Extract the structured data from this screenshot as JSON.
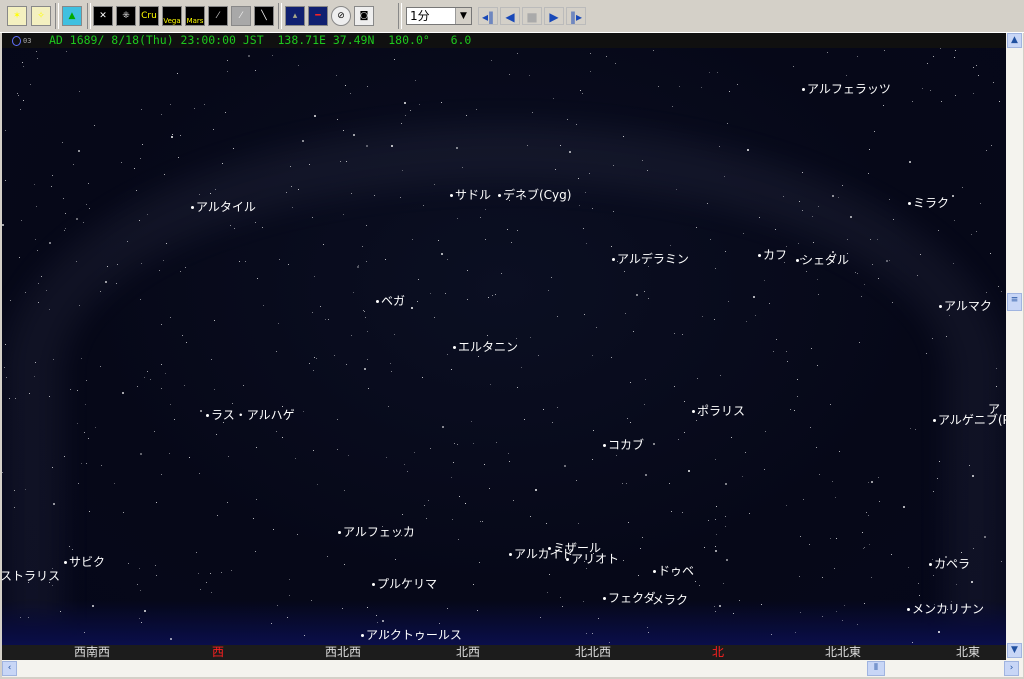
{
  "toolbar": {
    "buttons": [
      "star-brighter",
      "star-fainter",
      "landscape",
      "constellation-lines",
      "constellation-boundaries",
      "constellation-names",
      "Vega",
      "Mars",
      "comet",
      "meteor",
      "milky-way",
      "grid-horizon",
      "grid-equator",
      "telescope",
      "camera"
    ],
    "cru_label": "Cru",
    "vega_label": "Vega",
    "mars_label": "Mars",
    "speed": "1分",
    "playback": [
      "step-back",
      "reverse",
      "stop",
      "play",
      "step-forward"
    ]
  },
  "status": {
    "moon_age": "03",
    "text": "AD 1689/ 8/18(Thu) 23:00:00 JST  138.71E 37.49N  180.0°   6.0"
  },
  "stars": [
    "アルフェラッツ",
    "アルタイル",
    "サドル",
    "デネブ(Cyg)",
    "ミラク",
    "アルデラミン",
    "カフ",
    "シェダル",
    "ベガ",
    "アルマク",
    "エルタニン",
    "ラス・アルハゲ",
    "ポラリス",
    "アルゲニブ(P",
    "ア",
    "コカブ",
    "アルフェッカ",
    "サビク",
    "ストラリス",
    "アルカイド",
    "ミザール",
    "アリオト",
    "ドゥベ",
    "カペラ",
    "プルケリマ",
    "フェクダ",
    "メラク",
    "メンカリナン",
    "アルクトゥールス"
  ],
  "compass": [
    "西南西",
    "西",
    "西北西",
    "北西",
    "北北西",
    "北",
    "北北東",
    "北東"
  ],
  "colors": {
    "sky": "#060818",
    "status_text": "#1ec81e",
    "cardinal": "#ff2020"
  }
}
